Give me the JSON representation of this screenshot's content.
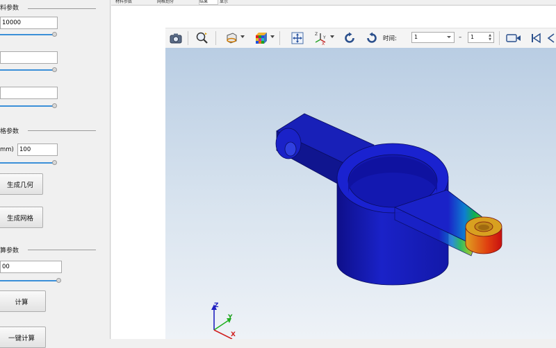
{
  "left_panel": {
    "group_material": {
      "title": "料参数"
    },
    "field_1": {
      "value": "10000"
    },
    "field_2": {
      "value": ""
    },
    "field_3": {
      "value": ""
    },
    "group_mesh": {
      "title": "格参数"
    },
    "mesh_size": {
      "label": "mm)",
      "value": "100"
    },
    "generate_geometry_button": "生成几何",
    "generate_mesh_button": "生成网格",
    "group_compute": {
      "title": "算参数"
    },
    "compute_field": {
      "value": "00"
    },
    "compute_button": "计算",
    "one_click_compute_button": "一键计算"
  },
  "tabs": [
    {
      "label": "材料参数"
    },
    {
      "label": "网格划分"
    },
    {
      "label": "结果"
    },
    {
      "label": "显示"
    }
  ],
  "toolbar": {
    "time_label": "时间:",
    "time_from": "1",
    "time_dash": "–",
    "time_to": "1",
    "icons": [
      "camera-icon",
      "zoom-icon",
      "section-view-icon",
      "color-cube-icon",
      "fit-all-icon",
      "axis-view-icon",
      "rotate-cw-icon",
      "rotate-ccw-icon",
      "record-icon",
      "first-frame-icon",
      "prev-frame-icon"
    ]
  },
  "triad": {
    "x": "X",
    "y": "Y",
    "z": "Z"
  },
  "colors": {
    "model_blue": "#1a22c8",
    "hot_red": "#d81c1c",
    "viewport_top": "#b9cde3",
    "slider_blue": "#3a8fd8"
  }
}
